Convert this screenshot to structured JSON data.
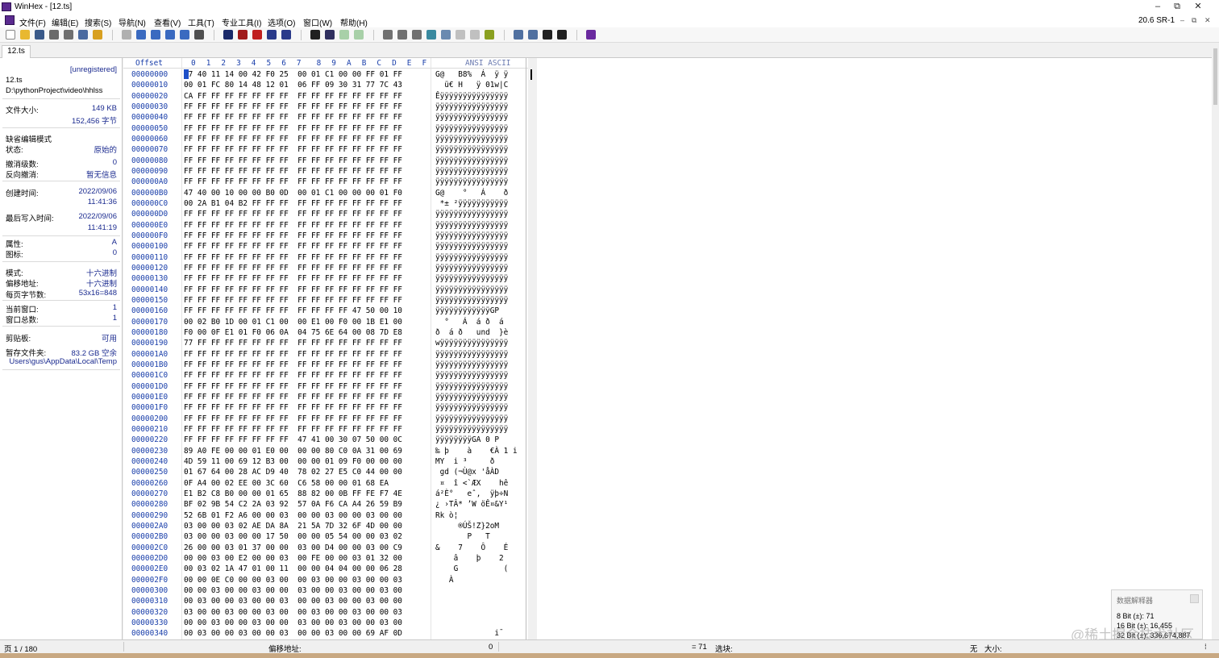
{
  "window": {
    "title": "WinHex - [12.ts]",
    "minimize": "–",
    "restore": "⧉",
    "close": "✕"
  },
  "menu": {
    "items": [
      "文件(F)",
      "编辑(E)",
      "搜索(S)",
      "导航(N)",
      "查看(V)",
      "工具(T)",
      "专业工具(I)",
      "选项(O)",
      "窗口(W)",
      "帮助(H)"
    ],
    "version": "20.6 SR-1",
    "mdi_min": "–",
    "mdi_restore": "⧉",
    "mdi_close": "✕"
  },
  "tab": {
    "label": "12.ts"
  },
  "info_panel": {
    "unregistered": "[unregistered]",
    "file_name": "12.ts",
    "file_path": "D:\\pythonProject\\video\\hhlss",
    "size_label": "文件大小:",
    "size_kb": "149 KB",
    "size_bytes": "152,456 字节",
    "edit_mode_label": "缺省编辑模式",
    "status_label": "状态:",
    "status_value": "原始的",
    "undo_level_label": "撤消级数:",
    "undo_level_value": "0",
    "redo_label": "反向撤消:",
    "redo_value": "暂无信息",
    "created_label": "创建时间:",
    "created_date": "2022/09/06",
    "created_time": "11:41:36",
    "modified_label": "最后写入时间:",
    "modified_date": "2022/09/06",
    "modified_time": "11:41:19",
    "attr_label": "属性:",
    "attr_value": "A",
    "icon_label": "图标:",
    "icon_value": "0",
    "mode_label": "模式:",
    "mode_value": "十六进制",
    "offset_label": "偏移地址:",
    "offset_value": "十六进制",
    "bytes_per_page_label": "每页字节数:",
    "bytes_per_page_value": "53x16=848",
    "current_window_label": "当前窗口:",
    "current_window_value": "1",
    "total_windows_label": "窗口总数:",
    "total_windows_value": "1",
    "clipboard_label": "剪贴板:",
    "clipboard_value": "可用",
    "temp_label": "暂存文件夹:",
    "temp_value": "83.2 GB 空余",
    "temp_path": "Users\\gus\\AppData\\Local\\Temp"
  },
  "hex_view": {
    "offset_header": "Offset",
    "column_headers": [
      "0",
      "1",
      "2",
      "3",
      "4",
      "5",
      "6",
      "7",
      "8",
      "9",
      "A",
      "B",
      "C",
      "D",
      "E",
      "F"
    ],
    "ascii_header": "ANSI ASCII",
    "rows": [
      {
        "offset": "00000000",
        "hex": "47 40 11 14 00 42 F0 25  00 01 C1 00 00 FF 01 FF",
        "ascii": "G@   B8%  Á  ÿ ÿ"
      },
      {
        "offset": "00000010",
        "hex": "00 01 FC 80 14 48 12 01  06 FF 09 30 31 77 7C 43",
        "ascii": "  ü€ H   ÿ 01w|C"
      },
      {
        "offset": "00000020",
        "hex": "CA FF FF FF FF FF FF FF  FF FF FF FF FF FF FF FF",
        "ascii": "Êÿÿÿÿÿÿÿÿÿÿÿÿÿÿÿ"
      },
      {
        "offset": "00000030",
        "hex": "FF FF FF FF FF FF FF FF  FF FF FF FF FF FF FF FF",
        "ascii": "ÿÿÿÿÿÿÿÿÿÿÿÿÿÿÿÿ"
      },
      {
        "offset": "00000040",
        "hex": "FF FF FF FF FF FF FF FF  FF FF FF FF FF FF FF FF",
        "ascii": "ÿÿÿÿÿÿÿÿÿÿÿÿÿÿÿÿ"
      },
      {
        "offset": "00000050",
        "hex": "FF FF FF FF FF FF FF FF  FF FF FF FF FF FF FF FF",
        "ascii": "ÿÿÿÿÿÿÿÿÿÿÿÿÿÿÿÿ"
      },
      {
        "offset": "00000060",
        "hex": "FF FF FF FF FF FF FF FF  FF FF FF FF FF FF FF FF",
        "ascii": "ÿÿÿÿÿÿÿÿÿÿÿÿÿÿÿÿ"
      },
      {
        "offset": "00000070",
        "hex": "FF FF FF FF FF FF FF FF  FF FF FF FF FF FF FF FF",
        "ascii": "ÿÿÿÿÿÿÿÿÿÿÿÿÿÿÿÿ"
      },
      {
        "offset": "00000080",
        "hex": "FF FF FF FF FF FF FF FF  FF FF FF FF FF FF FF FF",
        "ascii": "ÿÿÿÿÿÿÿÿÿÿÿÿÿÿÿÿ"
      },
      {
        "offset": "00000090",
        "hex": "FF FF FF FF FF FF FF FF  FF FF FF FF FF FF FF FF",
        "ascii": "ÿÿÿÿÿÿÿÿÿÿÿÿÿÿÿÿ"
      },
      {
        "offset": "000000A0",
        "hex": "FF FF FF FF FF FF FF FF  FF FF FF FF FF FF FF FF",
        "ascii": "ÿÿÿÿÿÿÿÿÿÿÿÿÿÿÿÿ"
      },
      {
        "offset": "000000B0",
        "hex": "47 40 00 10 00 00 B0 0D  00 01 C1 00 00 00 01 F0",
        "ascii": "G@    °   Á    ð"
      },
      {
        "offset": "000000C0",
        "hex": "00 2A B1 04 B2 FF FF FF  FF FF FF FF FF FF FF FF",
        "ascii": " *± ²ÿÿÿÿÿÿÿÿÿÿÿ"
      },
      {
        "offset": "000000D0",
        "hex": "FF FF FF FF FF FF FF FF  FF FF FF FF FF FF FF FF",
        "ascii": "ÿÿÿÿÿÿÿÿÿÿÿÿÿÿÿÿ"
      },
      {
        "offset": "000000E0",
        "hex": "FF FF FF FF FF FF FF FF  FF FF FF FF FF FF FF FF",
        "ascii": "ÿÿÿÿÿÿÿÿÿÿÿÿÿÿÿÿ"
      },
      {
        "offset": "000000F0",
        "hex": "FF FF FF FF FF FF FF FF  FF FF FF FF FF FF FF FF",
        "ascii": "ÿÿÿÿÿÿÿÿÿÿÿÿÿÿÿÿ"
      },
      {
        "offset": "00000100",
        "hex": "FF FF FF FF FF FF FF FF  FF FF FF FF FF FF FF FF",
        "ascii": "ÿÿÿÿÿÿÿÿÿÿÿÿÿÿÿÿ"
      },
      {
        "offset": "00000110",
        "hex": "FF FF FF FF FF FF FF FF  FF FF FF FF FF FF FF FF",
        "ascii": "ÿÿÿÿÿÿÿÿÿÿÿÿÿÿÿÿ"
      },
      {
        "offset": "00000120",
        "hex": "FF FF FF FF FF FF FF FF  FF FF FF FF FF FF FF FF",
        "ascii": "ÿÿÿÿÿÿÿÿÿÿÿÿÿÿÿÿ"
      },
      {
        "offset": "00000130",
        "hex": "FF FF FF FF FF FF FF FF  FF FF FF FF FF FF FF FF",
        "ascii": "ÿÿÿÿÿÿÿÿÿÿÿÿÿÿÿÿ"
      },
      {
        "offset": "00000140",
        "hex": "FF FF FF FF FF FF FF FF  FF FF FF FF FF FF FF FF",
        "ascii": "ÿÿÿÿÿÿÿÿÿÿÿÿÿÿÿÿ"
      },
      {
        "offset": "00000150",
        "hex": "FF FF FF FF FF FF FF FF  FF FF FF FF FF FF FF FF",
        "ascii": "ÿÿÿÿÿÿÿÿÿÿÿÿÿÿÿÿ"
      },
      {
        "offset": "00000160",
        "hex": "FF FF FF FF FF FF FF FF  FF FF FF FF 47 50 00 10",
        "ascii": "ÿÿÿÿÿÿÿÿÿÿÿÿGP  "
      },
      {
        "offset": "00000170",
        "hex": "00 02 B0 1D 00 01 C1 00  00 E1 00 F0 00 1B E1 00",
        "ascii": "  °   Á  á ð  á "
      },
      {
        "offset": "00000180",
        "hex": "F0 00 0F E1 01 F0 06 0A  04 75 6E 64 00 08 7D E8",
        "ascii": "ð  á ð   und  }è"
      },
      {
        "offset": "00000190",
        "hex": "77 FF FF FF FF FF FF FF  FF FF FF FF FF FF FF FF",
        "ascii": "wÿÿÿÿÿÿÿÿÿÿÿÿÿÿÿ"
      },
      {
        "offset": "000001A0",
        "hex": "FF FF FF FF FF FF FF FF  FF FF FF FF FF FF FF FF",
        "ascii": "ÿÿÿÿÿÿÿÿÿÿÿÿÿÿÿÿ"
      },
      {
        "offset": "000001B0",
        "hex": "FF FF FF FF FF FF FF FF  FF FF FF FF FF FF FF FF",
        "ascii": "ÿÿÿÿÿÿÿÿÿÿÿÿÿÿÿÿ"
      },
      {
        "offset": "000001C0",
        "hex": "FF FF FF FF FF FF FF FF  FF FF FF FF FF FF FF FF",
        "ascii": "ÿÿÿÿÿÿÿÿÿÿÿÿÿÿÿÿ"
      },
      {
        "offset": "000001D0",
        "hex": "FF FF FF FF FF FF FF FF  FF FF FF FF FF FF FF FF",
        "ascii": "ÿÿÿÿÿÿÿÿÿÿÿÿÿÿÿÿ"
      },
      {
        "offset": "000001E0",
        "hex": "FF FF FF FF FF FF FF FF  FF FF FF FF FF FF FF FF",
        "ascii": "ÿÿÿÿÿÿÿÿÿÿÿÿÿÿÿÿ"
      },
      {
        "offset": "000001F0",
        "hex": "FF FF FF FF FF FF FF FF  FF FF FF FF FF FF FF FF",
        "ascii": "ÿÿÿÿÿÿÿÿÿÿÿÿÿÿÿÿ"
      },
      {
        "offset": "00000200",
        "hex": "FF FF FF FF FF FF FF FF  FF FF FF FF FF FF FF FF",
        "ascii": "ÿÿÿÿÿÿÿÿÿÿÿÿÿÿÿÿ"
      },
      {
        "offset": "00000210",
        "hex": "FF FF FF FF FF FF FF FF  FF FF FF FF FF FF FF FF",
        "ascii": "ÿÿÿÿÿÿÿÿÿÿÿÿÿÿÿÿ"
      },
      {
        "offset": "00000220",
        "hex": "FF FF FF FF FF FF FF FF  47 41 00 30 07 50 00 0C",
        "ascii": "ÿÿÿÿÿÿÿÿGA 0 P  "
      },
      {
        "offset": "00000230",
        "hex": "89 A0 FE 00 00 01 E0 00  00 00 80 C0 0A 31 00 69",
        "ascii": "‰ þ    à    €À 1 i"
      },
      {
        "offset": "00000240",
        "hex": "4D 59 11 00 69 12 B3 00  00 00 01 09 F0 00 00 00",
        "ascii": "MY  i ³     ð   "
      },
      {
        "offset": "00000250",
        "hex": "01 67 64 00 28 AC D9 40  78 02 27 E5 C0 44 00 00",
        "ascii": " gd (¬Ù@x 'åÀD  "
      },
      {
        "offset": "00000260",
        "hex": "0F A4 00 02 EE 00 3C 60  C6 58 00 00 01 68 EA",
        "ascii": " ¤  î <`ÆX    hê"
      },
      {
        "offset": "00000270",
        "hex": "E1 B2 C8 B0 00 00 01 65  88 82 00 0B FF FE F7 4E",
        "ascii": "á²È°   eˆ‚  ÿþ÷N"
      },
      {
        "offset": "00000280",
        "hex": "BF 02 9B 54 C2 2A 03 92  57 0A F6 CA A4 26 59 B9",
        "ascii": "¿ ›TÂ* ’W öÊ¤&Y¹"
      },
      {
        "offset": "00000290",
        "hex": "52 6B 01 F2 A6 00 00 03  00 00 03 00 00 03 00 00",
        "ascii": "Rk ò¦           "
      },
      {
        "offset": "000002A0",
        "hex": "03 00 00 03 02 AE DA 8A  21 5A 7D 32 6F 4D 00 00",
        "ascii": "     ®ÚŠ!Z}2oM  "
      },
      {
        "offset": "000002B0",
        "hex": "03 00 00 03 00 00 17 50  00 00 05 54 00 00 03 02",
        "ascii": "       P   T    "
      },
      {
        "offset": "000002C0",
        "hex": "26 00 00 03 01 37 00 00  03 00 D4 00 00 03 00 C9",
        "ascii": "&    7    Ô    É"
      },
      {
        "offset": "000002D0",
        "hex": "00 00 03 00 E2 00 00 03  00 FE 00 00 03 01 32 00",
        "ascii": "    â    þ    2 "
      },
      {
        "offset": "000002E0",
        "hex": "00 03 02 1A 47 01 00 11  00 00 04 04 00 00 06 28",
        "ascii": "    G          ("
      },
      {
        "offset": "000002F0",
        "hex": "00 00 0E C0 00 00 03 00  00 03 00 00 03 00 00 03",
        "ascii": "   À            "
      },
      {
        "offset": "00000300",
        "hex": "00 00 03 00 00 03 00 00  03 00 00 03 00 00 03 00",
        "ascii": "                "
      },
      {
        "offset": "00000310",
        "hex": "00 03 00 00 03 00 00 03  00 00 03 00 00 03 00 00",
        "ascii": "                "
      },
      {
        "offset": "00000320",
        "hex": "03 00 00 03 00 00 03 00  00 03 00 00 03 00 00 03",
        "ascii": "                "
      },
      {
        "offset": "00000330",
        "hex": "00 00 03 00 00 03 00 00  03 00 00 03 00 00 03 00",
        "ascii": "                "
      },
      {
        "offset": "00000340",
        "hex": "00 03 00 00 03 00 00 03  00 00 03 00 00 69 AF 0D",
        "ascii": "             i¯ "
      }
    ]
  },
  "data_interpreter": {
    "title": "数据解释器",
    "bit8": "8 Bit (±): 71",
    "bit16": "16 Bit (±): 16,455",
    "bit32": "32 Bit (±): 336,674,887"
  },
  "status_bar": {
    "page": "页 1 / 180",
    "offset_label": "偏移地址:",
    "offset_value": "0",
    "value": "= 71",
    "selection_label": "选块:",
    "selection_value": "无",
    "size_label": "大小:"
  },
  "watermark": "@稀土掘金技术社区"
}
